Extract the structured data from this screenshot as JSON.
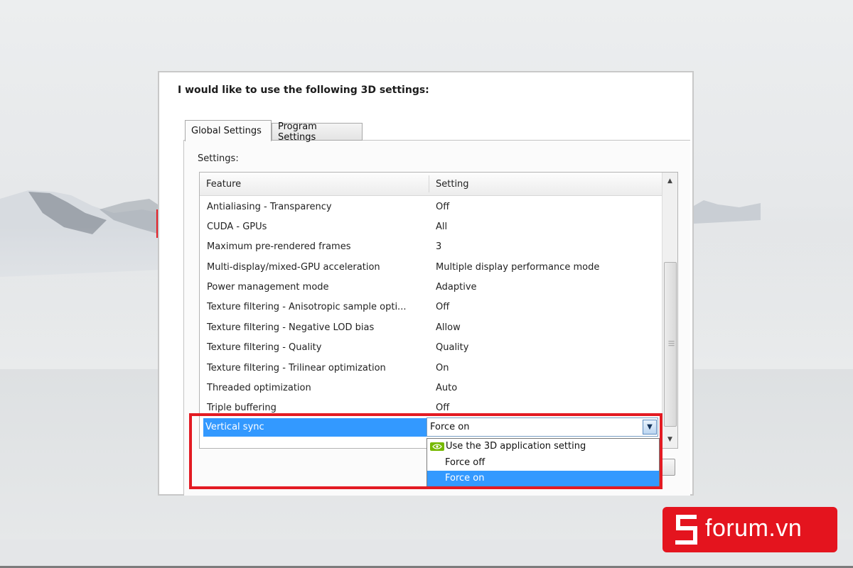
{
  "dialog": {
    "heading": "I would like to use the following 3D settings:",
    "tabs": [
      {
        "label": "Global Settings",
        "active": true
      },
      {
        "label": "Program Settings",
        "active": false
      }
    ],
    "settings_label": "Settings:",
    "columns": {
      "feature": "Feature",
      "setting": "Setting"
    },
    "rows": [
      {
        "feature": "Antialiasing - Transparency",
        "setting": "Off"
      },
      {
        "feature": "CUDA - GPUs",
        "setting": "All"
      },
      {
        "feature": "Maximum pre-rendered frames",
        "setting": "3"
      },
      {
        "feature": "Multi-display/mixed-GPU acceleration",
        "setting": "Multiple display performance mode"
      },
      {
        "feature": "Power management mode",
        "setting": "Adaptive"
      },
      {
        "feature": "Texture filtering - Anisotropic sample opti...",
        "setting": "Off"
      },
      {
        "feature": "Texture filtering - Negative LOD bias",
        "setting": "Allow"
      },
      {
        "feature": "Texture filtering - Quality",
        "setting": "Quality"
      },
      {
        "feature": "Texture filtering - Trilinear optimization",
        "setting": "On"
      },
      {
        "feature": "Threaded optimization",
        "setting": "Auto"
      },
      {
        "feature": "Triple buffering",
        "setting": "Off"
      }
    ],
    "selected_row": {
      "feature": "Vertical sync",
      "setting": "Force on"
    },
    "dropdown_options": [
      "Use the 3D application setting",
      "Force off",
      "Force on"
    ],
    "selected_option": "Force on"
  },
  "colors": {
    "selection": "#3399ff",
    "highlight_border": "#e31b23",
    "logo_bg": "#e4141e",
    "nvidia_green": "#76b900"
  },
  "logo": {
    "text": "forum.vn"
  }
}
